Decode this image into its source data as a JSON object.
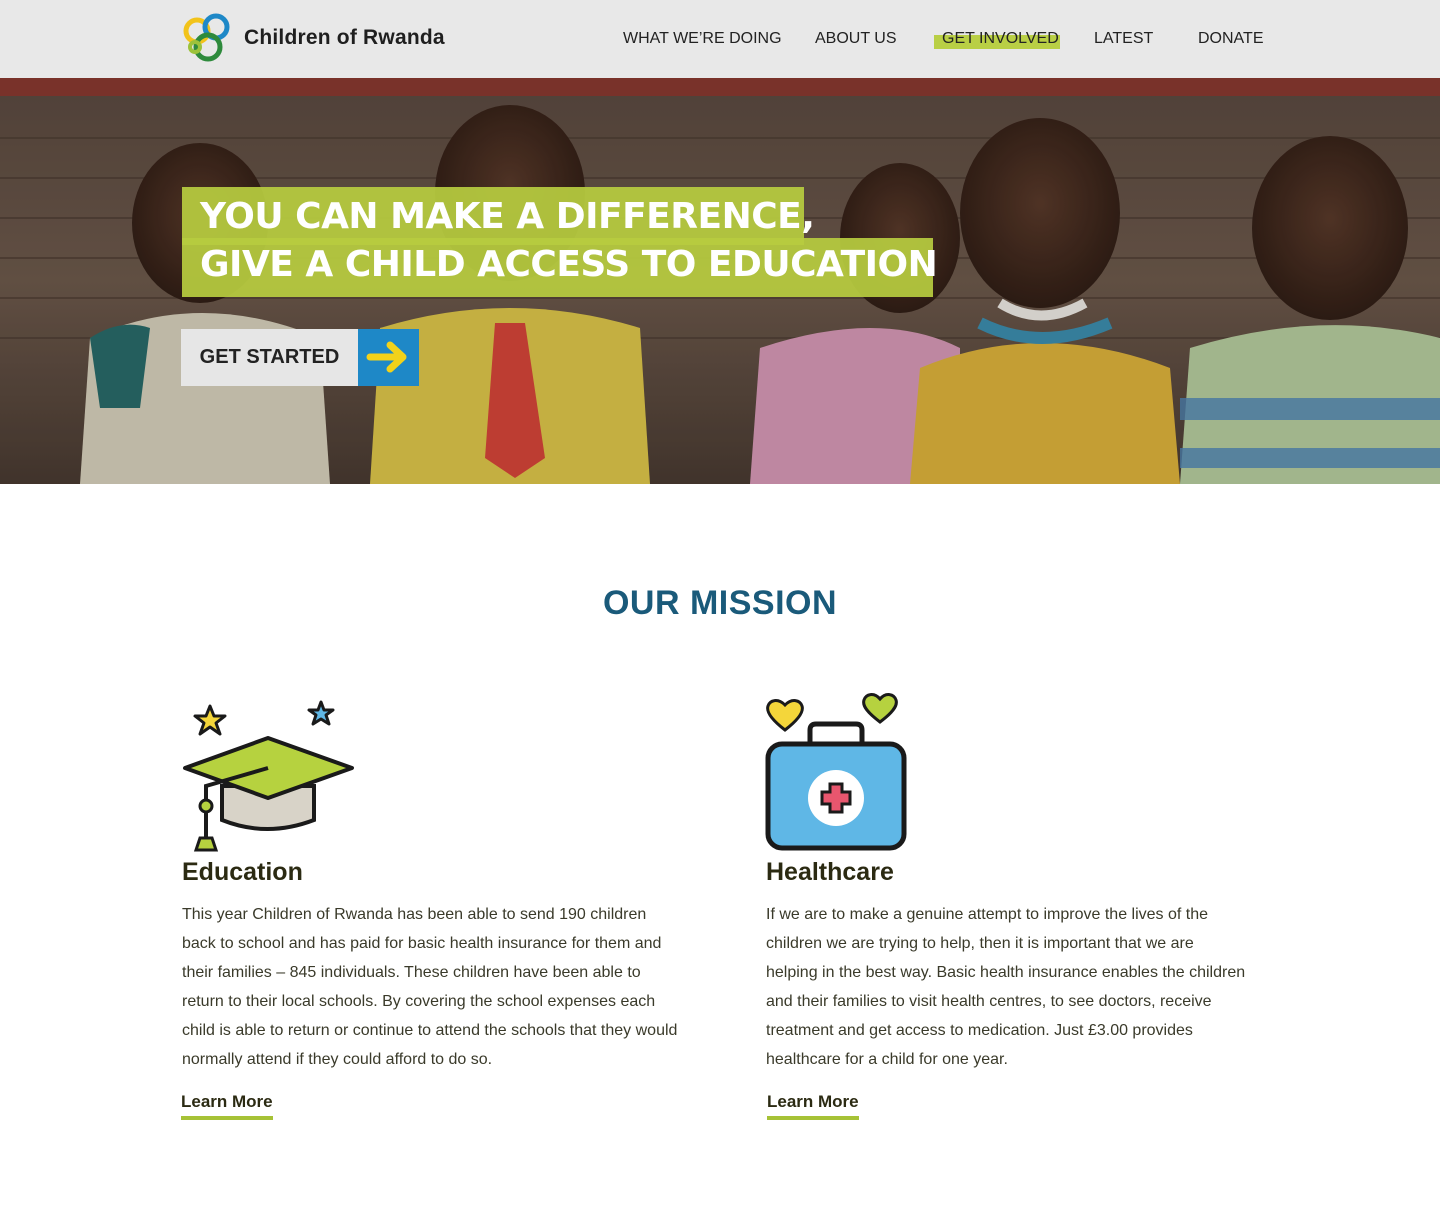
{
  "header": {
    "brand": "Children of Rwanda",
    "nav": [
      {
        "label": "WHAT WE’RE DOING"
      },
      {
        "label": "ABOUT US"
      },
      {
        "label": "GET INVOLVED"
      },
      {
        "label": "LATEST"
      },
      {
        "label": "DONATE"
      }
    ],
    "active_nav": "GET INVOLVED"
  },
  "hero": {
    "headline_line1": "YOU CAN MAKE A DIFFERENCE,",
    "headline_line2": "GIVE A CHILD ACCESS TO EDUCATION",
    "cta_label": "GET STARTED",
    "cta_icon": "arrow-right-icon"
  },
  "mission": {
    "title": "OUR MISSION",
    "items": [
      {
        "icon": "graduation-cap-icon",
        "title": "Education",
        "text": "This year Children of Rwanda has been able to send 190 children back to school and has paid for basic health insurance for them and their families – 845 individuals. These children have been able to return to their local schools. By covering the school expenses each child is able to return or continue to attend the schools that they would normally attend if they could afford to do so.",
        "link": "Learn More"
      },
      {
        "icon": "medical-kit-icon",
        "title": "Healthcare",
        "text": "If we are to make a genuine attempt to improve the lives of the children we are trying to help, then it is important that we are helping in the best way. Basic health insurance enables the children and their families to visit health centres, to see doctors, receive treatment and get access to medication. Just £3.00 provides healthcare for a child for one year.",
        "link": "Learn More"
      }
    ]
  },
  "colors": {
    "accent_green": "#b7cb3f",
    "accent_blue": "#1e88c7",
    "heading_blue": "#1a5a7a",
    "header_bg": "#e8e8e8"
  }
}
